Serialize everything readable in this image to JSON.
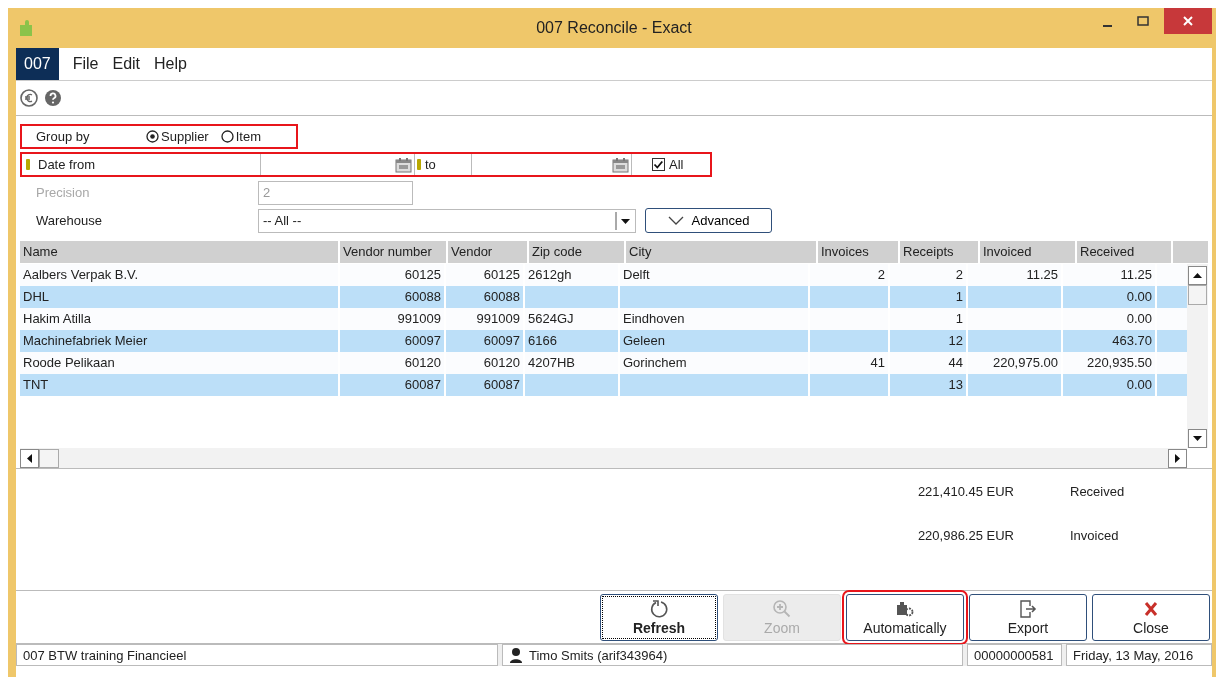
{
  "window": {
    "title": "007 Reconcile - Exact"
  },
  "menu": {
    "company": "007",
    "items": [
      "File",
      "Edit",
      "Help"
    ]
  },
  "form": {
    "group_by": {
      "label": "Group by",
      "highlighted": true,
      "options": [
        {
          "label": "Supplier",
          "selected": true
        },
        {
          "label": "Item",
          "selected": false
        }
      ]
    },
    "date": {
      "label": "Date from",
      "to_label": "to",
      "highlighted": true,
      "all": {
        "label": "All",
        "checked": true
      }
    },
    "precision": {
      "label": "Precision",
      "value": "2",
      "disabled": true
    },
    "warehouse": {
      "label": "Warehouse",
      "value": "-- All --"
    },
    "advanced_button": "Advanced"
  },
  "table": {
    "columns": [
      {
        "label": "Name",
        "kind": "text"
      },
      {
        "label": "Vendor number",
        "kind": "number"
      },
      {
        "label": "Vendor",
        "kind": "number"
      },
      {
        "label": "Zip code",
        "kind": "text"
      },
      {
        "label": "City",
        "kind": "text"
      },
      {
        "label": "Invoices",
        "kind": "number"
      },
      {
        "label": "Receipts",
        "kind": "number"
      },
      {
        "label": "Invoiced",
        "kind": "number"
      },
      {
        "label": "Received",
        "kind": "number"
      }
    ],
    "rows": [
      [
        "Aalbers Verpak B.V.",
        "60125",
        "60125",
        "2612gh",
        "Delft",
        "2",
        "2",
        "11.25",
        "11.25"
      ],
      [
        "DHL",
        "60088",
        "60088",
        "",
        "",
        "",
        "1",
        "",
        "0.00"
      ],
      [
        "Hakim Atilla",
        "991009",
        "991009",
        "5624GJ",
        "Eindhoven",
        "",
        "1",
        "",
        "0.00"
      ],
      [
        "Machinefabriek Meier",
        "60097",
        "60097",
        "6166",
        "Geleen",
        "",
        "12",
        "",
        "463.70"
      ],
      [
        "Roode Pelikaan",
        "60120",
        "60120",
        "4207HB",
        "Gorinchem",
        "41",
        "44",
        "220,975.00",
        "220,935.50"
      ],
      [
        "TNT",
        "60087",
        "60087",
        "",
        "",
        "",
        "13",
        "",
        "0.00"
      ]
    ]
  },
  "totals": [
    {
      "amount": "221,410.45 EUR",
      "label": "Received"
    },
    {
      "amount": "220,986.25 EUR",
      "label": "Invoiced"
    }
  ],
  "buttons": [
    {
      "label": "Refresh",
      "kind": "refresh",
      "disabled": false,
      "focused": true,
      "highlighted": false
    },
    {
      "label": "Zoom",
      "kind": "zoom",
      "disabled": true,
      "focused": false,
      "highlighted": false
    },
    {
      "label": "Automatically",
      "kind": "automatic",
      "disabled": false,
      "focused": false,
      "highlighted": true
    },
    {
      "label": "Export",
      "kind": "export",
      "disabled": false,
      "focused": false,
      "highlighted": false
    },
    {
      "label": "Close",
      "kind": "close",
      "disabled": false,
      "focused": false,
      "highlighted": false
    }
  ],
  "status_bar": {
    "company": "007 BTW training Financieel",
    "user": "Timo Smits (arif343964)",
    "number": "00000000581",
    "date": "Friday, 13 May, 2016"
  }
}
